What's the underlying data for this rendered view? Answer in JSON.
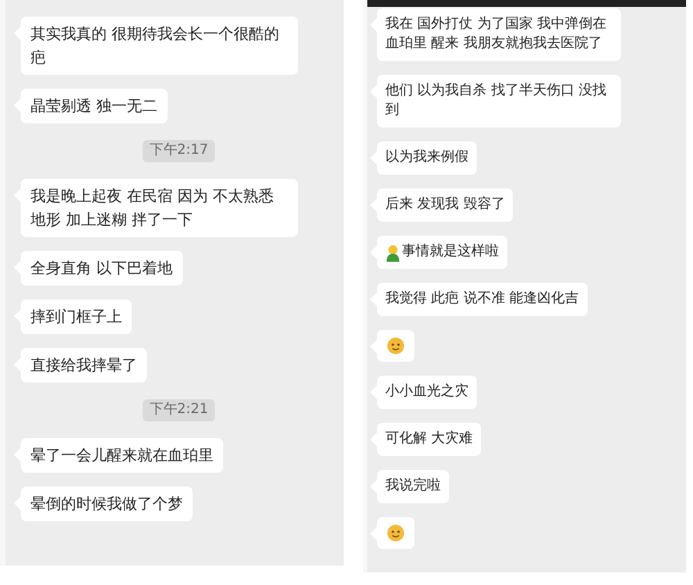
{
  "panels": [
    {
      "top_bar": false,
      "messages": [
        {
          "kind": "text",
          "text": "其实我真的 很期待我会长一个很酷的疤"
        },
        {
          "kind": "text",
          "text": "晶莹剔透 独一无二"
        },
        {
          "kind": "time",
          "text": "下午2:17"
        },
        {
          "kind": "text",
          "text": "我是晚上起夜 在民宿 因为 不太熟悉地形 加上迷糊 拌了一下"
        },
        {
          "kind": "text",
          "text": "全身直角 以下巴着地"
        },
        {
          "kind": "text",
          "text": "摔到门框子上"
        },
        {
          "kind": "text",
          "text": "直接给我摔晕了"
        },
        {
          "kind": "time",
          "text": "下午2:21"
        },
        {
          "kind": "text",
          "text": "晕了一会儿醒来就在血珀里"
        },
        {
          "kind": "text",
          "text": "晕倒的时候我做了个梦"
        }
      ]
    },
    {
      "top_bar": true,
      "messages": [
        {
          "kind": "text",
          "text": "我在 国外打仗 为了国家 我中弹倒在血珀里 醒来 我朋友就抱我去医院了"
        },
        {
          "kind": "text",
          "text": "他们 以为我自杀 找了半天伤口 没找到"
        },
        {
          "kind": "text",
          "text": "以为我来例假"
        },
        {
          "kind": "text",
          "text": "后来 发现我 毁容了"
        },
        {
          "kind": "icon_text",
          "text": "事情就是这样啦"
        },
        {
          "kind": "text",
          "text": "我觉得 此疤 说不准 能逢凶化吉"
        },
        {
          "kind": "emoji"
        },
        {
          "kind": "text",
          "text": "小小血光之灾"
        },
        {
          "kind": "text",
          "text": "可化解 大灾难"
        },
        {
          "kind": "text",
          "text": "我说完啦"
        },
        {
          "kind": "emoji"
        }
      ]
    }
  ]
}
